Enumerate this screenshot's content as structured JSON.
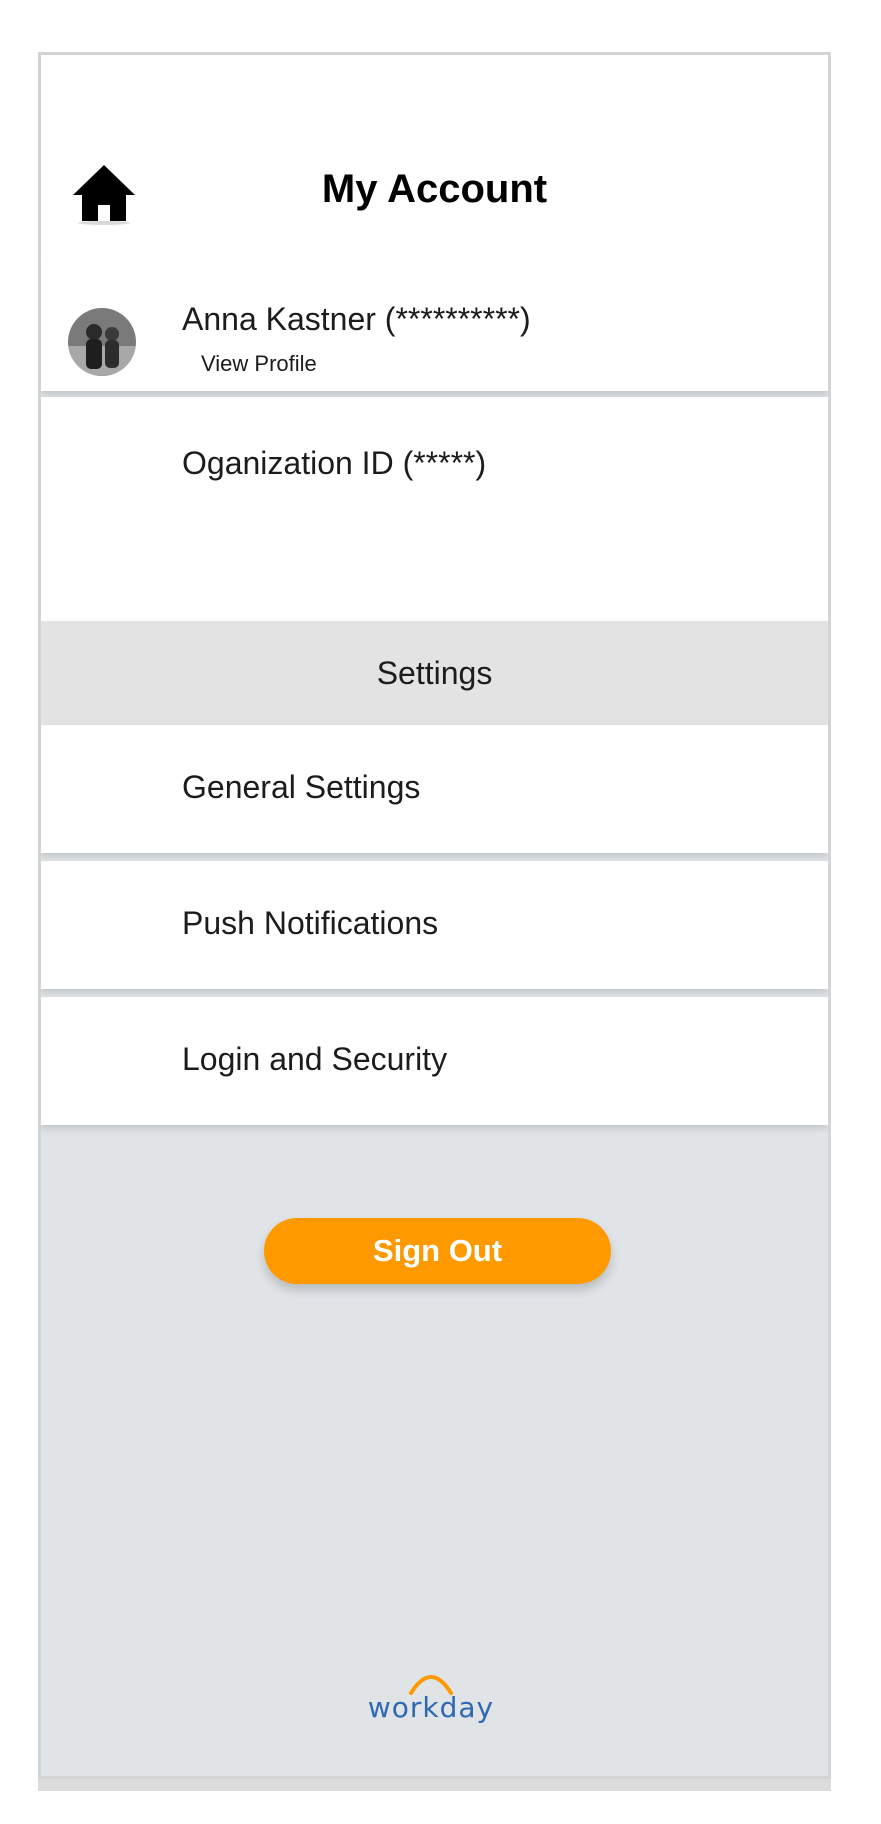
{
  "header": {
    "title": "My Account",
    "home_icon": "home-icon"
  },
  "profile": {
    "name": "Anna Kastner",
    "masked_id": "(**********)",
    "name_line": "Anna Kastner  (**********)",
    "view_profile_label": "View Profile"
  },
  "organization": {
    "label": "Oganization ID  (*****)"
  },
  "settings": {
    "section_title": "Settings",
    "items": [
      {
        "label": "General Settings"
      },
      {
        "label": "Push Notifications"
      },
      {
        "label": "Login and Security"
      }
    ]
  },
  "sign_out": {
    "label": "Sign Out"
  },
  "logo": {
    "text": "workday",
    "arc_color": "#ff9900",
    "text_color": "#2f68b3"
  },
  "colors": {
    "accent": "#ff9900",
    "background": "#e0e4e7",
    "section_bg": "#e3e3e3"
  }
}
